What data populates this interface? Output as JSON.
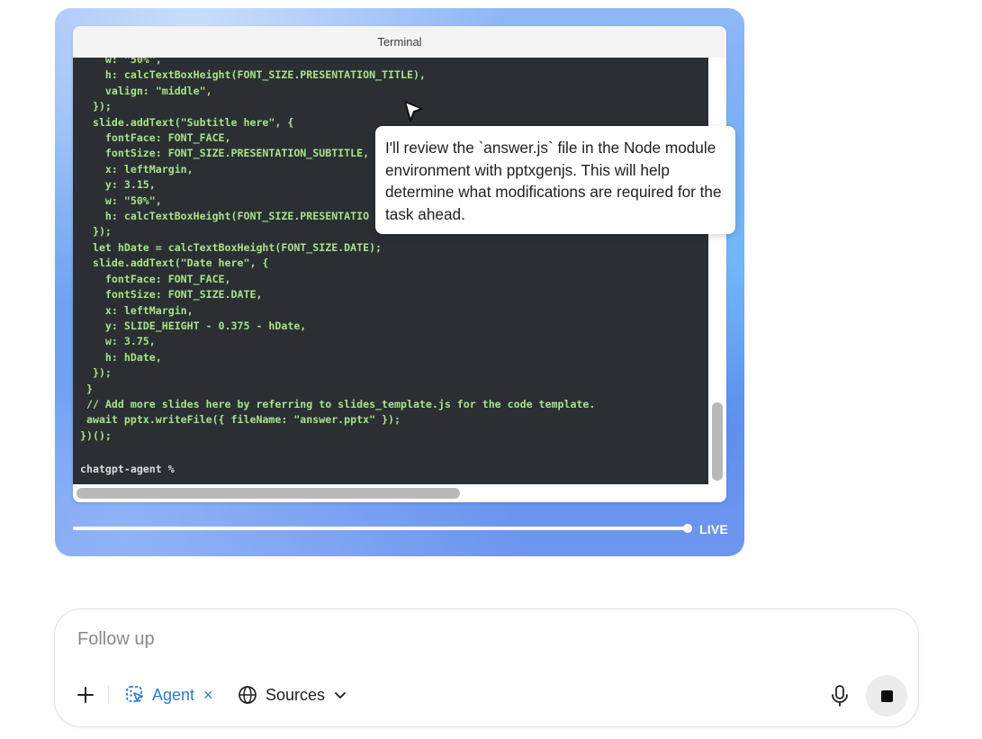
{
  "terminal": {
    "title": "Terminal",
    "code": "    w: \"50%\",\n    h: calcTextBoxHeight(FONT_SIZE.PRESENTATION_TITLE),\n    valign: \"middle\",\n  });\n  slide.addText(\"Subtitle here\", {\n    fontFace: FONT_FACE,\n    fontSize: FONT_SIZE.PRESENTATION_SUBTITLE,\n    x: leftMargin,\n    y: 3.15,\n    w: \"50%\",\n    h: calcTextBoxHeight(FONT_SIZE.PRESENTATIO\n  });\n  let hDate = calcTextBoxHeight(FONT_SIZE.DATE);\n  slide.addText(\"Date here\", {\n    fontFace: FONT_FACE,\n    fontSize: FONT_SIZE.DATE,\n    x: leftMargin,\n    y: SLIDE_HEIGHT - 0.375 - hDate,\n    w: 3.75,\n    h: hDate,\n  });\n }\n // Add more slides here by referring to slides_template.js for the code template.\n await pptx.writeFile({ fileName: \"answer.pptx\" });\n})();",
    "prompt": "chatgpt-agent %"
  },
  "playback": {
    "progress": 1.0,
    "live_label": "LIVE"
  },
  "tooltip": {
    "text": "I'll review the `answer.js` file in the Node module environment with pptxgenjs. This will help determine what modifications are required for the task ahead."
  },
  "composer": {
    "placeholder": "Follow up",
    "agent_label": "Agent",
    "agent_close": "×",
    "sources_label": "Sources"
  },
  "colors": {
    "code_text": "#a6e38a",
    "terminal_bg": "#2b2f33",
    "accent": "#2a7ad9"
  },
  "icons": [
    "pointer-cursor-icon",
    "plus-icon",
    "agent-icon",
    "close-icon",
    "globe-icon",
    "chevron-down-icon",
    "microphone-icon",
    "stop-icon"
  ]
}
